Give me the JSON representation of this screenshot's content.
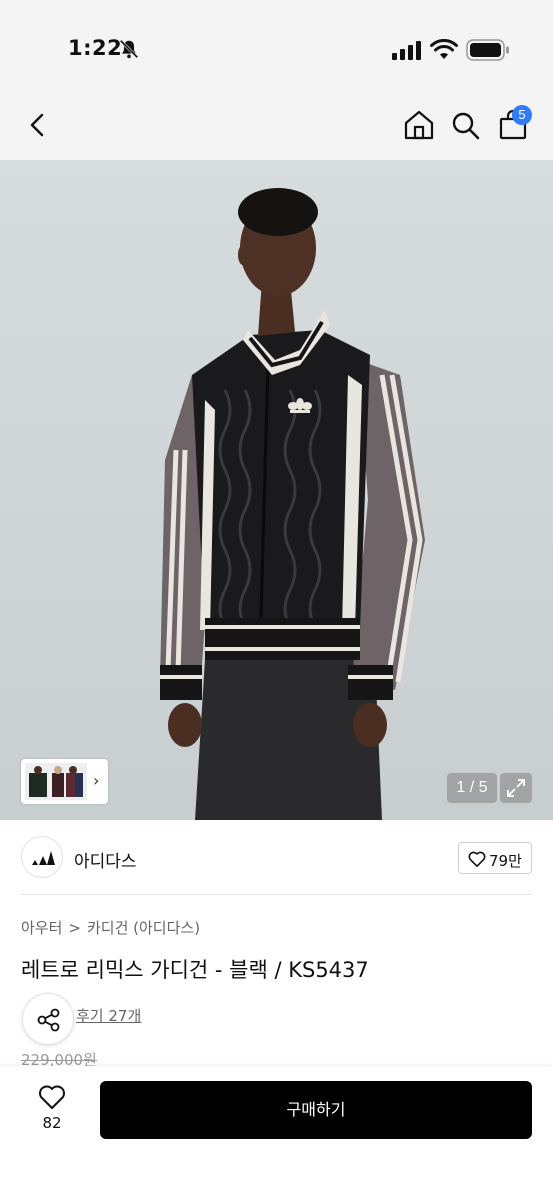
{
  "status_bar": {
    "time": "1:22",
    "icons": [
      "bell-slash-icon",
      "signal-icon",
      "wifi-icon",
      "battery-icon"
    ]
  },
  "nav": {
    "icons": [
      "back-icon",
      "home-icon",
      "search-icon",
      "bag-icon"
    ],
    "cart_count": "5"
  },
  "gallery": {
    "page_indicator": "1 / 5",
    "thumbnail_chevron": "›"
  },
  "brand": {
    "name": "아디다스",
    "likes": "79만"
  },
  "product": {
    "breadcrumb": [
      "아우터",
      "카디건 (아디다스)"
    ],
    "breadcrumb_separator": ">",
    "title": "레트로 리믹스 가디건 - 블랙 / KS5437",
    "reviews": "후기 27개",
    "original_price": "229,000원"
  },
  "bottom_bar": {
    "wish_count": "82",
    "buy_label": "구매하기"
  },
  "colors": {
    "accent_badge": "#2f7cf6",
    "buy_button": "#000000"
  }
}
